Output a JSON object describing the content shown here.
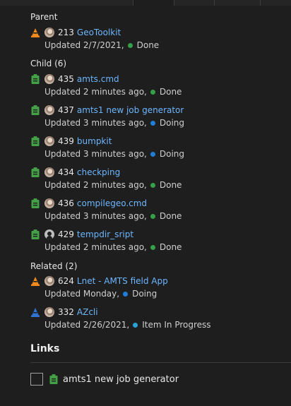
{
  "sections": {
    "parent": "Parent",
    "child": "Child (6)",
    "related": "Related (2)",
    "links": "Links"
  },
  "colors": {
    "bug": "#f08a1a",
    "task": "#43a047",
    "epic": "#2e74d0",
    "done": "#35a04a",
    "doing": "#1f7fd8",
    "in_progress": "#2aa4d8",
    "link": "#6cb6ff"
  },
  "items": [
    {
      "type": "bug-icon",
      "avatar": "photo",
      "id": "213",
      "title": "GeoToolkit",
      "updated": "Updated 2/7/2021,",
      "state": "Done",
      "state_color": "green"
    },
    {
      "type": "task-icon",
      "avatar": "photo",
      "id": "435",
      "title": "amts.cmd",
      "updated": "Updated 2 minutes ago,",
      "state": "Done",
      "state_color": "green"
    },
    {
      "type": "task-icon",
      "avatar": "photo",
      "id": "437",
      "title": "amts1 new job generator",
      "updated": "Updated 3 minutes ago,",
      "state": "Doing",
      "state_color": "blue"
    },
    {
      "type": "task-icon",
      "avatar": "photo",
      "id": "439",
      "title": "bumpkit",
      "updated": "Updated 3 minutes ago,",
      "state": "Doing",
      "state_color": "blue"
    },
    {
      "type": "task-icon",
      "avatar": "photo",
      "id": "434",
      "title": "checkping",
      "updated": "Updated 2 minutes ago,",
      "state": "Done",
      "state_color": "green"
    },
    {
      "type": "task-icon",
      "avatar": "photo",
      "id": "436",
      "title": "compilegeo.cmd",
      "updated": "Updated 3 minutes ago,",
      "state": "Done",
      "state_color": "green"
    },
    {
      "type": "task-icon",
      "avatar": "ghost",
      "id": "429",
      "title": "tempdir_sript",
      "updated": "Updated 2 minutes ago,",
      "state": "Done",
      "state_color": "green"
    },
    {
      "type": "bug-icon",
      "avatar": "photo",
      "id": "624",
      "title": "Lnet - AMTS field App",
      "updated": "Updated Monday,",
      "state": "Doing",
      "state_color": "blue"
    },
    {
      "type": "epic-icon",
      "avatar": "photo",
      "id": "332",
      "title": "AZcli",
      "updated": "Updated 2/26/2021,",
      "state": "Item In Progress",
      "state_color": "teal"
    }
  ],
  "links": {
    "row_label": "amts1 new job generator"
  }
}
